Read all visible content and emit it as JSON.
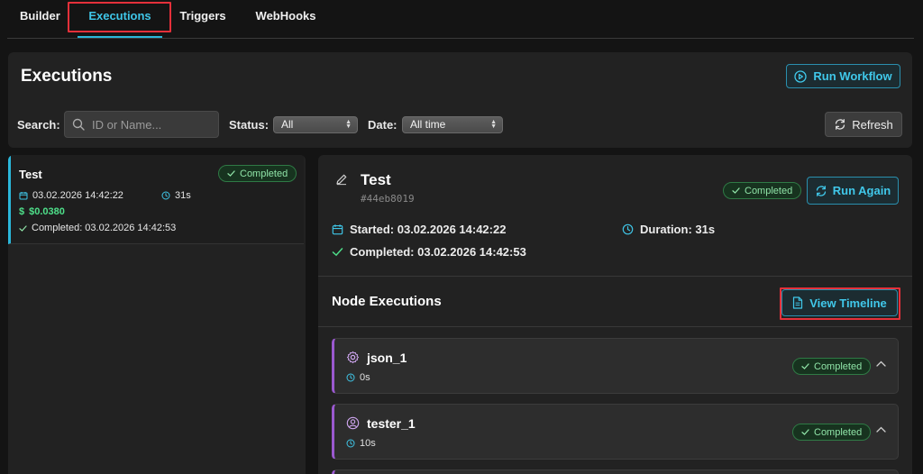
{
  "tabs": [
    {
      "label": "Builder"
    },
    {
      "label": "Executions"
    },
    {
      "label": "Triggers"
    },
    {
      "label": "WebHooks"
    }
  ],
  "header": {
    "title": "Executions",
    "run_workflow_label": "Run Workflow",
    "search_label": "Search:",
    "search_placeholder": "ID or Name...",
    "status_label": "Status:",
    "status_value": "All",
    "date_label": "Date:",
    "date_value": "All time",
    "refresh_label": "Refresh"
  },
  "executions": [
    {
      "name": "Test",
      "status": "Completed",
      "started": "03.02.2026 14:42:22",
      "duration": "31s",
      "cost": "$0.0380",
      "completed": "Completed: 03.02.2026 14:42:53"
    }
  ],
  "detail": {
    "title": "Test",
    "id": "#44eb8019",
    "status": "Completed",
    "run_again_label": "Run Again",
    "started": "Started: 03.02.2026 14:42:22",
    "duration": "Duration: 31s",
    "completed": "Completed: 03.02.2026 14:42:53",
    "nodes_title": "Node Executions",
    "view_timeline_label": "View Timeline",
    "nodes": [
      {
        "name": "json_1",
        "duration": "0s",
        "status": "Completed",
        "icon": "gear-icon"
      },
      {
        "name": "tester_1",
        "duration": "10s",
        "status": "Completed",
        "icon": "user-icon"
      }
    ]
  },
  "colors": {
    "accent": "#2bb7da",
    "success": "#8fe3a7",
    "node_accent": "#9b59d0",
    "highlight": "#e5303a"
  }
}
